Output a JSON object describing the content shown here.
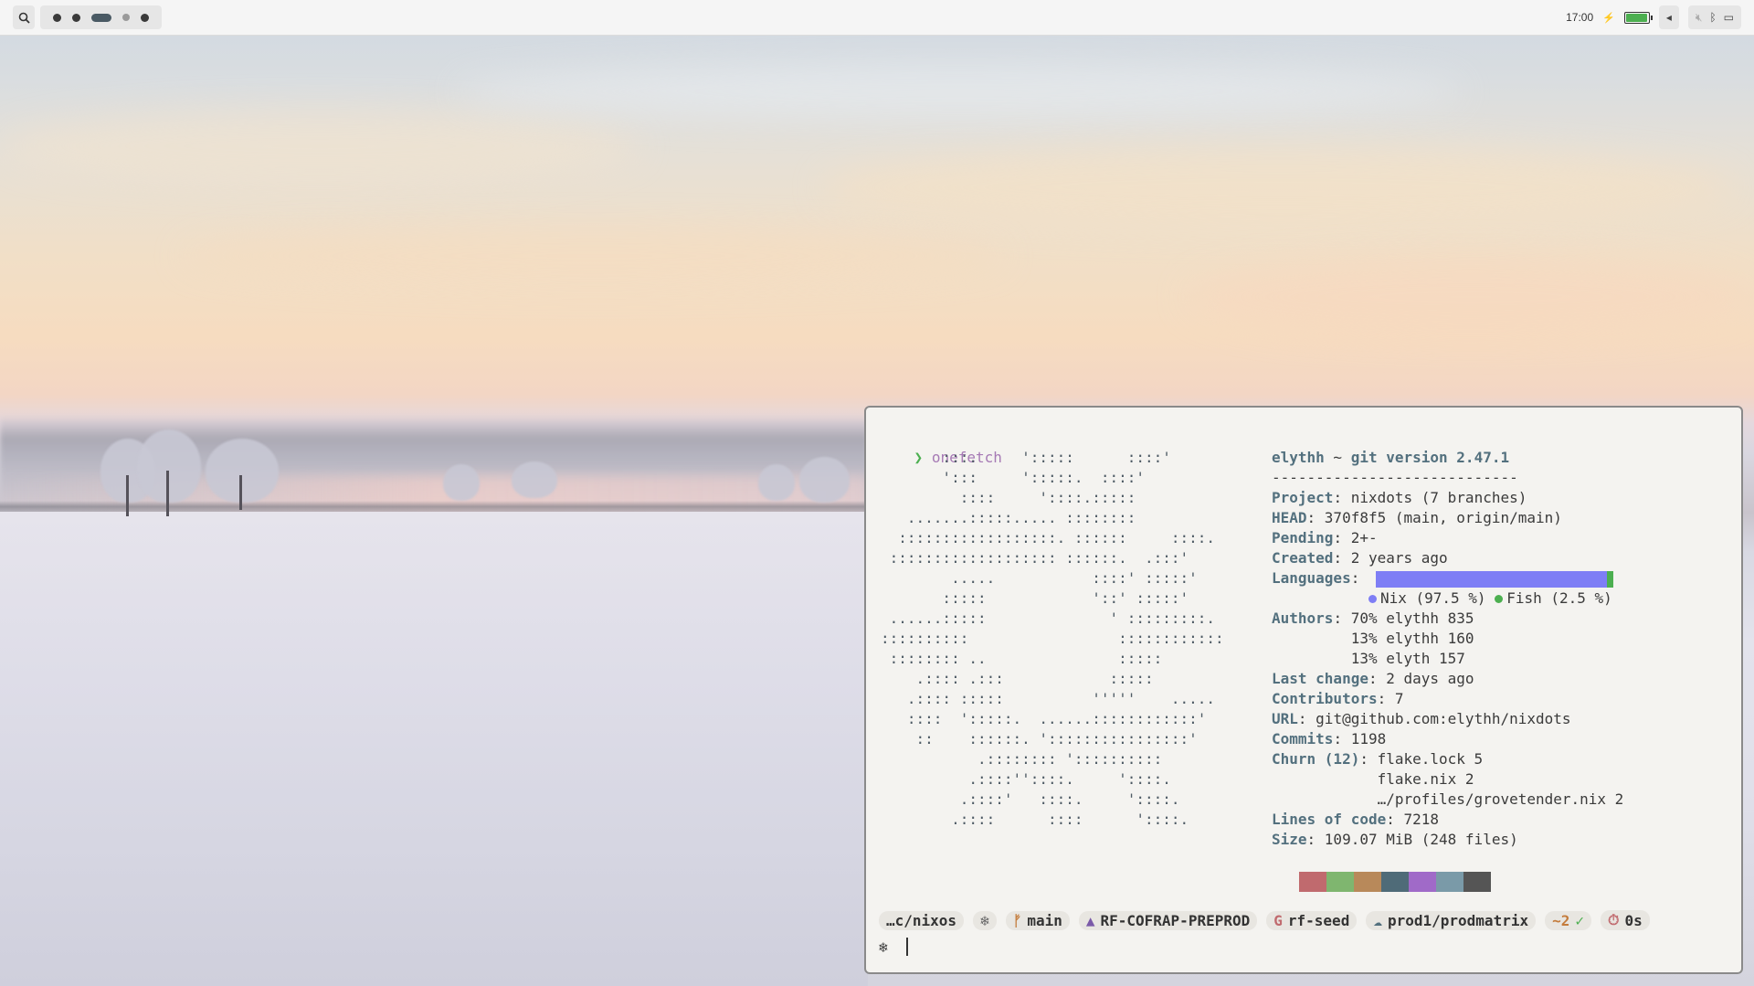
{
  "topbar": {
    "search_icon": "search-icon",
    "workspaces": [
      "1",
      "2",
      "3",
      "4",
      "5"
    ],
    "active_workspace": 3,
    "clock": "17:00",
    "battery_level": 0.95,
    "tray_icons": [
      "chevron-left-icon",
      "mute-icon",
      "bluetooth-icon",
      "window-icon"
    ]
  },
  "terminal": {
    "prompt_symbol": "❯",
    "command": "onefetch",
    "ascii_art": "       :::.     ':::::      ::::'\n       ':::     ':::::.  ::::'\n         ::::     '::::.:::::\n   .......:::::..... ::::::::\n  ::::::::::::::::::. ::::::     ::::.\n ::::::::::::::::::: ::::::.  .:::'\n        .....           ::::' :::::'\n       :::::            '::' :::::'\n ......:::::              ' :::::::::.\n::::::::::                 ::::::::::::\n :::::::: ..               :::::\n    .:::: .:::            :::::\n   .:::: :::::          '''''    .....\n   ::::  ':::::.  ......::::::::::::'\n    ::    ::::::. '::::::::::::::::'\n           .:::::::: '::::::::::\n          .::::''::::.     '::::.\n         .::::'   ::::.     '::::.\n        .::::      ::::      '::::.",
    "header_user": "elythh",
    "header_sep": " ~ ",
    "header_git": "git version 2.47.1",
    "divider": "----------------------------",
    "info": {
      "project_label": "Project",
      "project_value": "nixdots (7 branches)",
      "head_label": "HEAD",
      "head_value": "370f8f5 (main, origin/main)",
      "pending_label": "Pending",
      "pending_value": "2+-",
      "created_label": "Created",
      "created_value": "2 years ago",
      "languages_label": "Languages",
      "languages": [
        {
          "name": "Nix",
          "percent_text": "Nix (97.5 %)",
          "percent": 97.5,
          "color": "#7e7ef5"
        },
        {
          "name": "Fish",
          "percent_text": "Fish (2.5 %)",
          "percent": 2.5,
          "color": "#4caf50"
        }
      ],
      "authors_label": "Authors",
      "authors": [
        "70% elythh 835",
        "13% elythh 160",
        "13% elyth 157"
      ],
      "last_change_label": "Last change",
      "last_change_value": "2 days ago",
      "contributors_label": "Contributors",
      "contributors_value": "7",
      "url_label": "URL",
      "url_value": "git@github.com:elythh/nixdots",
      "commits_label": "Commits",
      "commits_value": "1198",
      "churn_label": "Churn (12)",
      "churn": [
        "flake.lock 5",
        "flake.nix 2",
        "…/profiles/grovetender.nix 2"
      ],
      "loc_label": "Lines of code",
      "loc_value": "7218",
      "size_label": "Size",
      "size_value": "109.07 MiB (248 files)"
    },
    "palette": [
      "#c06a6e",
      "#7fb66f",
      "#b8895a",
      "#4f6b78",
      "#a06ac8",
      "#7a9aa8",
      "#555555"
    ],
    "status": {
      "dir": "…c/nixos",
      "nix_icon": "nix-icon",
      "branch_icon": "branch-icon",
      "branch": "main",
      "k8s_icon": "k8s-icon",
      "context": "RF-COFRAP-PREPROD",
      "gcp_icon": "google-icon",
      "gcp_project": "rf-seed",
      "cloud_icon": "cloud-icon",
      "cloud": "prod1/prodmatrix",
      "git_status": "~2",
      "check": "✓",
      "timer_icon": "timer-icon",
      "duration": "0s"
    },
    "second_prompt": "❄"
  }
}
